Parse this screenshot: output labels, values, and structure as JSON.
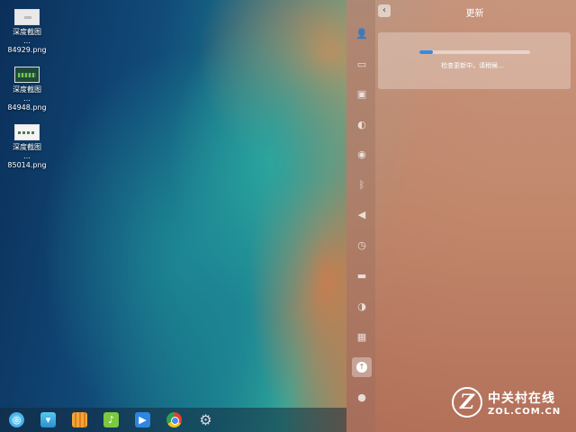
{
  "desktop": {
    "icons": [
      {
        "name_line1": "深度截图",
        "name_line2": "…84929.png"
      },
      {
        "name_line1": "深度截图",
        "name_line2": "…84948.png"
      },
      {
        "name_line1": "深度截图",
        "name_line2": "…85014.png"
      }
    ]
  },
  "dock": {
    "items": [
      "launcher-icon",
      "app-store-icon",
      "file-manager-icon",
      "music-icon",
      "video-player-icon",
      "browser-icon",
      "settings-icon"
    ]
  },
  "control_center": {
    "back_label": "‹",
    "title": "更新",
    "nav_icons": [
      {
        "icon": "account-icon",
        "glyph": "👤"
      },
      {
        "icon": "display-icon",
        "glyph": "▭"
      },
      {
        "icon": "default-apps-icon",
        "glyph": "▣"
      },
      {
        "icon": "personalization-icon",
        "glyph": "◐"
      },
      {
        "icon": "network-icon",
        "glyph": "◉"
      },
      {
        "icon": "bluetooth-icon",
        "glyph": "ᛒ"
      },
      {
        "icon": "sound-icon",
        "glyph": "◀"
      },
      {
        "icon": "time-icon",
        "glyph": "◷"
      },
      {
        "icon": "power-icon",
        "glyph": "▬"
      },
      {
        "icon": "mouse-icon",
        "glyph": "◑"
      },
      {
        "icon": "keyboard-icon",
        "glyph": "▦"
      },
      {
        "icon": "update-icon",
        "glyph": "↑"
      },
      {
        "icon": "info-icon",
        "glyph": "●"
      }
    ],
    "update": {
      "status_text": "检查更新中，请稍候...",
      "progress": 0.12
    }
  },
  "watermark": {
    "logo_letter": "Z",
    "cn": "中关村在线",
    "en": "ZOL.COM.CN"
  },
  "colors": {
    "progress": "#2f8ee6"
  }
}
